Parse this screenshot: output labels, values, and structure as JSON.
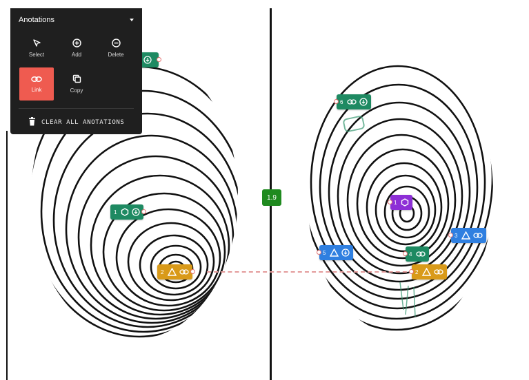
{
  "panel": {
    "title": "Anotations",
    "tools": [
      {
        "label": "Select",
        "icon": "cursor-icon"
      },
      {
        "label": "Add",
        "icon": "plus-circle-icon"
      },
      {
        "label": "Delete",
        "icon": "minus-circle-icon"
      },
      {
        "label": "Link",
        "icon": "link-icon",
        "active": true
      },
      {
        "label": "Copy",
        "icon": "copy-icon"
      }
    ],
    "clear_label": "CLEAR ALL ANOTATIONS"
  },
  "match_score": "1.9",
  "markers": {
    "left": [
      {
        "num": "1",
        "color": "#1e8a62",
        "icons": [
          "hexagon-icon",
          "download-circle-icon"
        ]
      },
      {
        "num": "2",
        "color": "#d99a19",
        "icons": [
          "triangle-icon",
          "link-icon"
        ]
      }
    ],
    "right": [
      {
        "num": "6",
        "color": "#1e8a62",
        "icons": [
          "link-icon",
          "download-circle-icon"
        ]
      },
      {
        "num": "1",
        "color": "#8d2fd6",
        "icons": [
          "hexagon-icon"
        ]
      },
      {
        "num": "3",
        "color": "#2f7fe0",
        "icons": [
          "triangle-icon",
          "link-icon"
        ]
      },
      {
        "num": "5",
        "color": "#2f7fe0",
        "icons": [
          "triangle-icon",
          "download-circle-icon"
        ]
      },
      {
        "num": "4",
        "color": "#1e8a62",
        "icons": [
          "link-icon"
        ]
      },
      {
        "num": "2",
        "color": "#d99a19",
        "icons": [
          "triangle-icon",
          "link-icon"
        ]
      }
    ]
  },
  "colors": {
    "panel_bg": "#1f1f1f",
    "active_tool": "#ef5b50",
    "link_line": "#e39a9a",
    "score_bg": "#1f8a1f"
  }
}
